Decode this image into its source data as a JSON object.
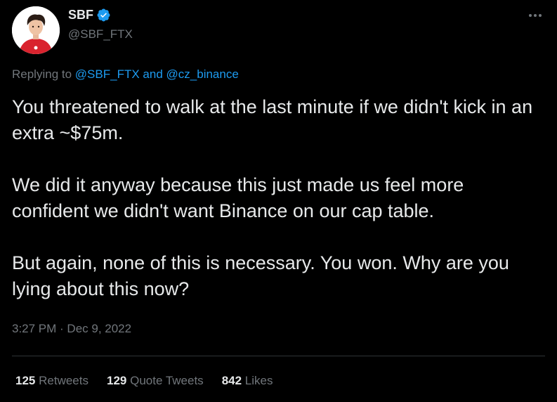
{
  "author": {
    "display_name": "SBF",
    "handle": "@SBF_FTX",
    "verified": true,
    "verified_color": "#1d9bf0",
    "avatar_icon": "user-avatar-red-shirt"
  },
  "menu": {
    "icon": "more-horizontal-icon"
  },
  "reply": {
    "prefix": "Replying to",
    "mention1": "@SBF_FTX",
    "conjunction": "and",
    "mention2": "@cz_binance"
  },
  "tweet": {
    "paragraphs": [
      "You threatened to walk at the last minute if we didn't kick in an extra ~$75m.",
      "We did it anyway because this just made us feel more confident we didn't want Binance on our cap table.",
      "But again, none of this is necessary.  You won.  Why are you lying about this now?"
    ],
    "timestamp": "3:27 PM · Dec 9, 2022"
  },
  "stats": [
    {
      "count": "125",
      "label": "Retweets"
    },
    {
      "count": "129",
      "label": "Quote Tweets"
    },
    {
      "count": "842",
      "label": "Likes"
    }
  ],
  "colors": {
    "background": "#000000",
    "text": "#e7e9ea",
    "muted": "#71767b",
    "accent": "#1d9bf0",
    "divider": "#2f3336"
  }
}
